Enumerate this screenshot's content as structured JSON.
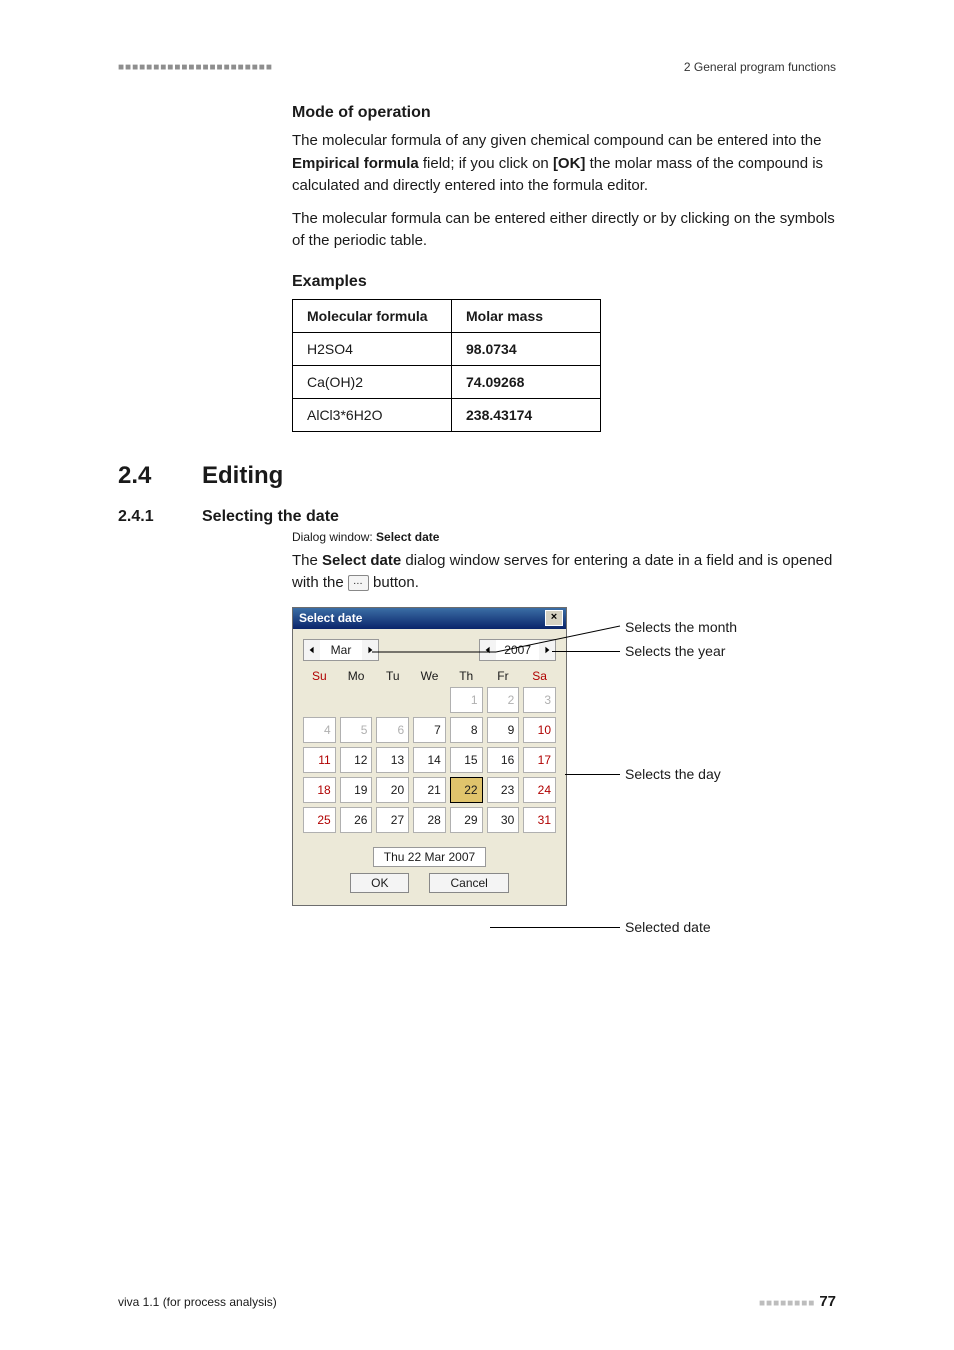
{
  "header": {
    "dashes": "■■■■■■■■■■■■■■■■■■■■■■",
    "right": "2 General program functions"
  },
  "s1": {
    "title": "Mode of operation",
    "para1_a": "The molecular formula of any given chemical compound can be entered into the ",
    "para1_b": "Empirical formula",
    "para1_c": " field; if you click on ",
    "para1_d": "[OK]",
    "para1_e": " the molar mass of the compound is calculated and directly entered into the formula editor.",
    "para2": "The molecular formula can be entered either directly or by clicking on the symbols of the periodic table."
  },
  "examples": {
    "title": "Examples",
    "head1": "Molecular formula",
    "head2": "Molar mass",
    "rows": [
      {
        "f": "H2SO4",
        "m": "98.0734"
      },
      {
        "f": "Ca(OH)2",
        "m": "74.09268"
      },
      {
        "f": "AlCl3*6H2O",
        "m": "238.43174"
      }
    ]
  },
  "heading": {
    "num": "2.4",
    "txt": "Editing"
  },
  "subheading": {
    "num": "2.4.1",
    "txt": "Selecting the date"
  },
  "dialoglabel_a": "Dialog window: ",
  "dialoglabel_b": "Select date",
  "sel_para_a": "The ",
  "sel_para_b": "Select date",
  "sel_para_c": " dialog window serves for entering a date in a field and is opened with the ",
  "sel_para_d": " button.",
  "ellipsis": "…",
  "datedialog": {
    "title": "Select date",
    "month": "Mar",
    "year": "2007",
    "weekdays": [
      "Su",
      "Mo",
      "Tu",
      "We",
      "Th",
      "Fr",
      "Sa"
    ],
    "grid": [
      {
        "v": "",
        "cls": "empty"
      },
      {
        "v": "",
        "cls": "empty"
      },
      {
        "v": "",
        "cls": "empty"
      },
      {
        "v": "",
        "cls": "empty"
      },
      {
        "v": "1",
        "cls": "other"
      },
      {
        "v": "2",
        "cls": "other"
      },
      {
        "v": "3",
        "cls": "other"
      },
      {
        "v": "4",
        "cls": "other wknd"
      },
      {
        "v": "5",
        "cls": "other"
      },
      {
        "v": "6",
        "cls": "other"
      },
      {
        "v": "7",
        "cls": ""
      },
      {
        "v": "8",
        "cls": ""
      },
      {
        "v": "9",
        "cls": ""
      },
      {
        "v": "10",
        "cls": "wknd"
      },
      {
        "v": "11",
        "cls": "wknd"
      },
      {
        "v": "12",
        "cls": ""
      },
      {
        "v": "13",
        "cls": ""
      },
      {
        "v": "14",
        "cls": ""
      },
      {
        "v": "15",
        "cls": ""
      },
      {
        "v": "16",
        "cls": ""
      },
      {
        "v": "17",
        "cls": "wknd"
      },
      {
        "v": "18",
        "cls": "wknd"
      },
      {
        "v": "19",
        "cls": ""
      },
      {
        "v": "20",
        "cls": ""
      },
      {
        "v": "21",
        "cls": ""
      },
      {
        "v": "22",
        "cls": "selected"
      },
      {
        "v": "23",
        "cls": ""
      },
      {
        "v": "24",
        "cls": "wknd"
      },
      {
        "v": "25",
        "cls": "wknd"
      },
      {
        "v": "26",
        "cls": ""
      },
      {
        "v": "27",
        "cls": ""
      },
      {
        "v": "28",
        "cls": ""
      },
      {
        "v": "29",
        "cls": ""
      },
      {
        "v": "30",
        "cls": ""
      },
      {
        "v": "31",
        "cls": "wknd"
      }
    ],
    "selected_text": "Thu  22 Mar 2007",
    "ok": "OK",
    "cancel": "Cancel"
  },
  "callouts": {
    "month": "Selects the month",
    "year": "Selects the year",
    "day": "Selects the day",
    "date": "Selected date"
  },
  "footer": {
    "left": "viva 1.1 (for process analysis)",
    "dashes": "■■■■■■■■",
    "page": "77"
  }
}
